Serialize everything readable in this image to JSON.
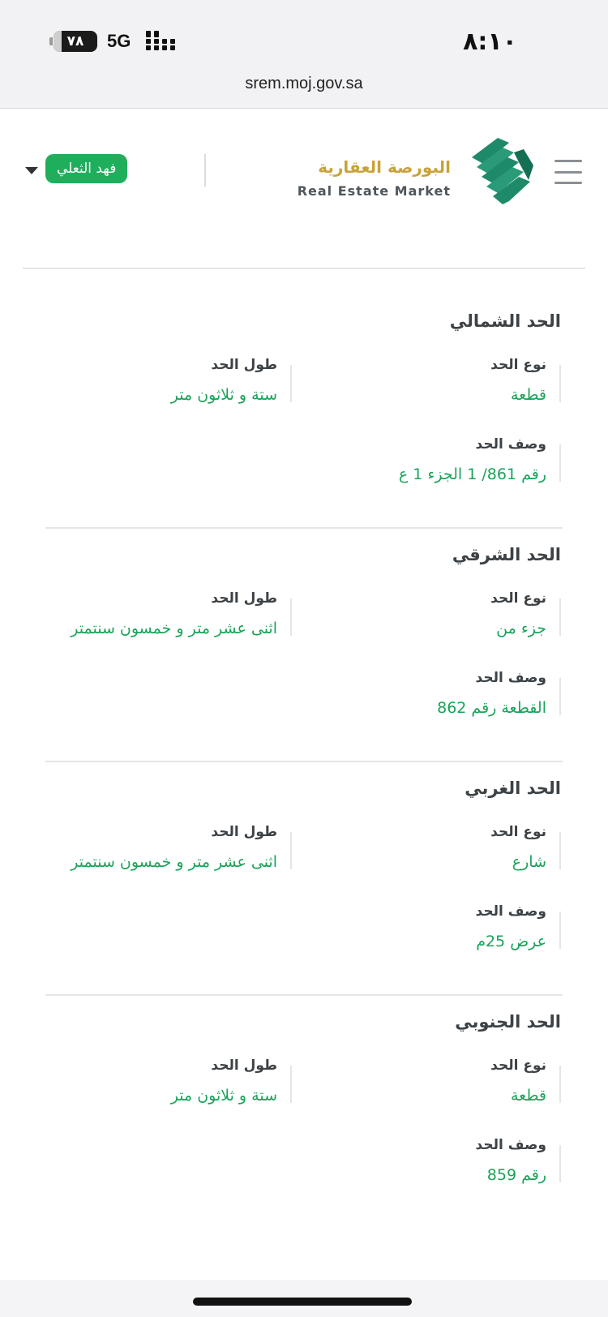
{
  "status_bar": {
    "battery": "٧٨",
    "network": "5G",
    "time": "٨:١٠"
  },
  "browser": {
    "url": "srem.moj.gov.sa"
  },
  "header": {
    "logo_ar": "البورصة العقارية",
    "logo_en": "Real Estate Market",
    "user_name": "فهد الثعلي",
    "brand_green": "#1fae5b",
    "brand_gold": "#c8a23b"
  },
  "labels": {
    "type": "نوع الحد",
    "length": "طول الحد",
    "description": "وصف الحد"
  },
  "boundaries": [
    {
      "title": "الحد الشمالي",
      "type": "قطعة",
      "length": "ستة و ثلاثون متر",
      "description": "رقم 861/ 1 الجزء 1 ع"
    },
    {
      "title": "الحد الشرقي",
      "type": "جزء من",
      "length": "اثنى عشر متر و خمسون سنتمتر",
      "description": "القطعة رقم 862"
    },
    {
      "title": "الحد الغربي",
      "type": "شارع",
      "length": "اثنى عشر متر و خمسون سنتمتر",
      "description": "عرض 25م"
    },
    {
      "title": "الحد الجنوبي",
      "type": "قطعة",
      "length": "ستة و ثلاثون متر",
      "description": "رقم 859"
    }
  ]
}
